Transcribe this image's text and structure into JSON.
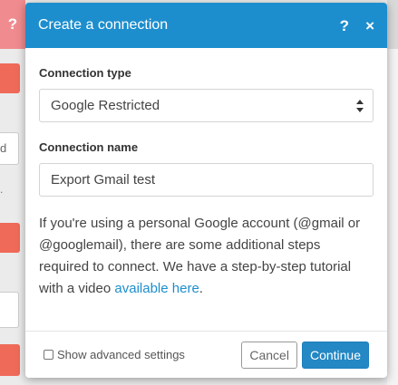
{
  "background": {
    "help_icon": "?",
    "field_fragment": "d",
    "dot": "."
  },
  "dialog": {
    "title": "Create a connection",
    "help_icon": "?",
    "close_icon": "×",
    "connection_type": {
      "label": "Connection type",
      "value": "Google Restricted"
    },
    "connection_name": {
      "label": "Connection name",
      "value": "Export Gmail test"
    },
    "help_text": "If you're using a personal Google account (@gmail or @googlemail), there are some additional steps required to connect. We have a step-by-step tutorial with a video ",
    "help_link": "available here",
    "help_text_end": ".",
    "footer": {
      "advanced_label": "Show advanced settings",
      "cancel_label": "Cancel",
      "continue_label": "Continue"
    }
  },
  "colors": {
    "header": "#1d8ecd",
    "link": "#1d8ecd",
    "primary_button": "#2388c4",
    "background_button": "#ef6a59",
    "background_help": "#f08c8f"
  }
}
